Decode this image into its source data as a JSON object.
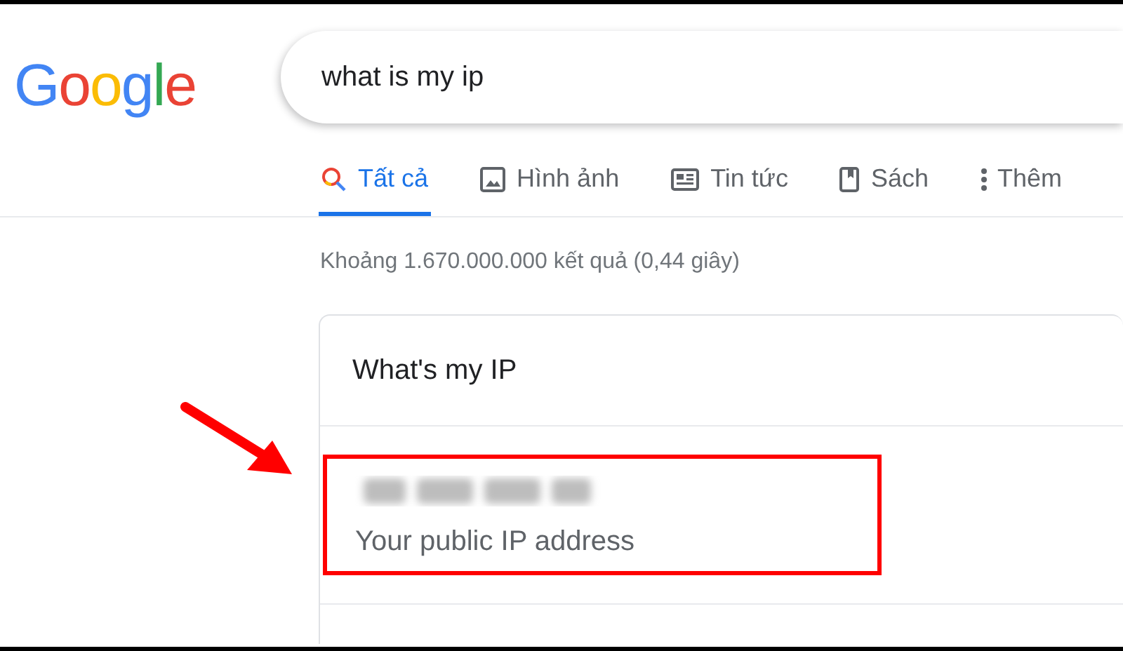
{
  "search": {
    "value": "what is my ip"
  },
  "logo": {
    "letters": [
      {
        "text": "G",
        "color": "#4285f4"
      },
      {
        "text": "o",
        "color": "#ea4335"
      },
      {
        "text": "o",
        "color": "#fbbc05"
      },
      {
        "text": "g",
        "color": "#4285f4"
      },
      {
        "text": "l",
        "color": "#34a853"
      },
      {
        "text": "e",
        "color": "#ea4335"
      }
    ]
  },
  "tabs": [
    {
      "label": "Tất cả",
      "kind": "search",
      "selected": true
    },
    {
      "label": "Hình ảnh",
      "kind": "image",
      "selected": false
    },
    {
      "label": "Tin tức",
      "kind": "news",
      "selected": false
    },
    {
      "label": "Sách",
      "kind": "book",
      "selected": false
    },
    {
      "label": "Thêm",
      "kind": "more",
      "selected": false
    }
  ],
  "result_stats": "Khoảng 1.670.000.000 kết quả (0,44 giây)",
  "card": {
    "title": "What's my IP",
    "ip_caption": "Your public IP address"
  }
}
